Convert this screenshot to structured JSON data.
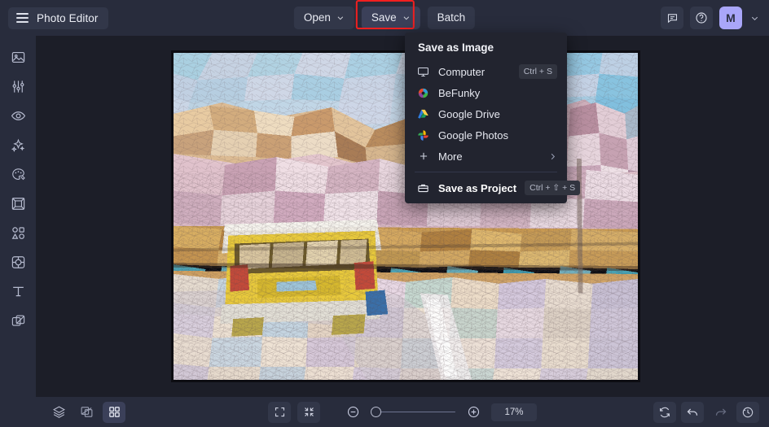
{
  "header": {
    "menu_icon": "hamburger-icon",
    "brand_title": "Photo Editor",
    "buttons": [
      {
        "label": "Open",
        "has_chevron": true,
        "name": "open-button"
      },
      {
        "label": "Save",
        "has_chevron": true,
        "name": "save-button",
        "highlighted": true,
        "highlight_color": "#f21f1f"
      },
      {
        "label": "Batch",
        "has_chevron": false,
        "name": "batch-button"
      }
    ],
    "right_icons": [
      {
        "name": "feedback-icon"
      },
      {
        "name": "help-icon"
      }
    ],
    "avatar": {
      "initial": "M",
      "color": "#a9a6f9"
    },
    "avatar_chevron_icon": "chevron-down-icon"
  },
  "sidebar": {
    "items": [
      {
        "name": "sidebar-item-image",
        "icon": "image-icon"
      },
      {
        "name": "sidebar-item-edit",
        "icon": "sliders-icon"
      },
      {
        "name": "sidebar-item-touchup",
        "icon": "eye-icon"
      },
      {
        "name": "sidebar-item-effects",
        "icon": "sparkles-icon"
      },
      {
        "name": "sidebar-item-artsy",
        "icon": "palette-icon"
      },
      {
        "name": "sidebar-item-frames",
        "icon": "frame-icon"
      },
      {
        "name": "sidebar-item-graphics",
        "icon": "shapes-icon"
      },
      {
        "name": "sidebar-item-overlays",
        "icon": "overlay-icon"
      },
      {
        "name": "sidebar-item-text",
        "icon": "text-icon"
      },
      {
        "name": "sidebar-item-textures",
        "icon": "texture-icon"
      }
    ]
  },
  "dropdown": {
    "title": "Save as Image",
    "items": [
      {
        "label": "Computer",
        "icon": "monitor-icon",
        "shortcut": "Ctrl + S",
        "name": "save-to-computer-item"
      },
      {
        "label": "BeFunky",
        "icon": "befunky-icon",
        "shortcut": "",
        "name": "save-to-befunky-item"
      },
      {
        "label": "Google Drive",
        "icon": "google-drive-icon",
        "shortcut": "",
        "name": "save-to-google-drive-item"
      },
      {
        "label": "Google Photos",
        "icon": "google-photos-icon",
        "shortcut": "",
        "name": "save-to-google-photos-item"
      },
      {
        "label": "More",
        "icon": "plus-icon",
        "shortcut": "",
        "name": "save-more-item",
        "chevron": true
      }
    ],
    "project": {
      "label": "Save as Project",
      "icon": "briefcase-icon",
      "shortcut": "Ctrl + ⇧ + S",
      "name": "save-as-project-item"
    }
  },
  "bottombar": {
    "left_tools": [
      {
        "name": "layers-button",
        "icon": "layers-icon",
        "active": false
      },
      {
        "name": "compare-button",
        "icon": "compare-icon",
        "active": false
      },
      {
        "name": "grid-button",
        "icon": "grid-icon",
        "active": true
      }
    ],
    "view_tools": [
      {
        "name": "fit-screen-button",
        "icon": "expand-icon"
      },
      {
        "name": "actual-size-button",
        "icon": "collapse-icon"
      }
    ],
    "zoom_out": {
      "name": "zoom-out-button",
      "icon": "minus-circle-icon"
    },
    "zoom_in": {
      "name": "zoom-in-button",
      "icon": "plus-circle-icon"
    },
    "zoom_level": "17%",
    "slider_percent": 0,
    "right_tools": [
      {
        "name": "reset-button",
        "icon": "reset-icon",
        "disabled": false
      },
      {
        "name": "undo-button",
        "icon": "undo-icon",
        "disabled": false
      },
      {
        "name": "redo-button",
        "icon": "redo-icon",
        "disabled": true
      },
      {
        "name": "history-button",
        "icon": "history-icon",
        "disabled": false
      }
    ]
  },
  "canvas": {
    "name": "image-canvas",
    "description": "Stained-glass mosaic stylized photo of a yellow VW camper van on a desert canyon road"
  }
}
